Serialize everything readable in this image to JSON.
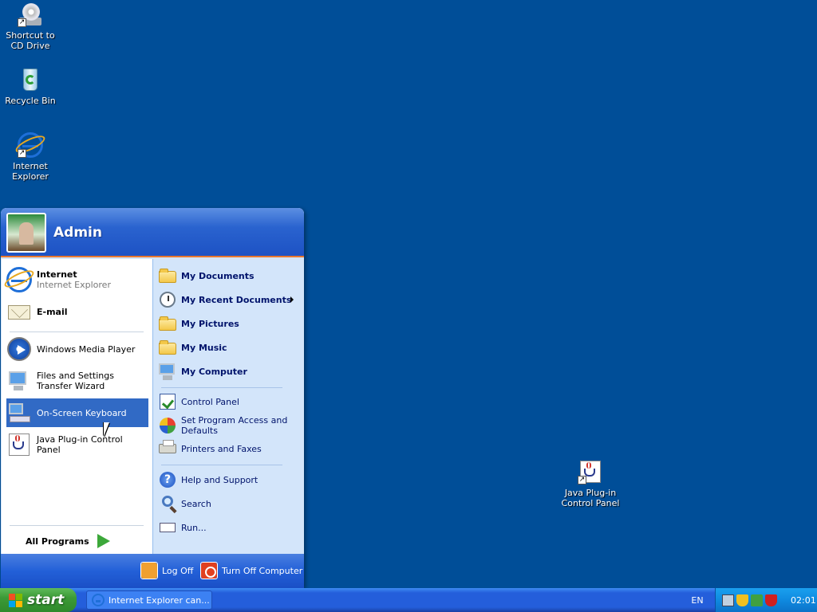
{
  "desktop": {
    "icons": [
      {
        "label": "Shortcut to CD Drive",
        "icon": "cd-drive-icon"
      },
      {
        "label": "Recycle Bin",
        "icon": "recycle-bin-icon"
      },
      {
        "label": "Internet Explorer",
        "icon": "internet-explorer-icon"
      },
      {
        "label": "Java Plug-in Control Panel",
        "icon": "java-icon"
      }
    ],
    "background_color": "#004e98"
  },
  "start_menu": {
    "user_name": "Admin",
    "pinned": [
      {
        "title": "Internet",
        "subtitle": "Internet Explorer",
        "icon": "internet-explorer-icon"
      },
      {
        "title": "E-mail",
        "icon": "email-icon"
      }
    ],
    "recent": [
      {
        "label": "Windows Media Player",
        "icon": "media-player-icon"
      },
      {
        "label": "Files and Settings Transfer Wizard",
        "icon": "transfer-wizard-icon"
      },
      {
        "label": "On-Screen Keyboard",
        "icon": "keyboard-icon",
        "highlighted": true
      },
      {
        "label": "Java Plug-in Control Panel",
        "icon": "java-icon"
      }
    ],
    "all_programs_label": "All Programs",
    "places": [
      {
        "label": "My Documents",
        "icon": "folder-icon"
      },
      {
        "label": "My Recent Documents",
        "icon": "recent-documents-icon",
        "submenu": true
      },
      {
        "label": "My Pictures",
        "icon": "folder-icon"
      },
      {
        "label": "My Music",
        "icon": "folder-icon"
      },
      {
        "label": "My Computer",
        "icon": "computer-icon"
      }
    ],
    "settings": [
      {
        "label": "Control Panel",
        "icon": "control-panel-icon"
      },
      {
        "label": "Set Program Access and Defaults",
        "icon": "program-access-icon"
      },
      {
        "label": "Printers and Faxes",
        "icon": "printer-icon"
      }
    ],
    "help": [
      {
        "label": "Help and Support",
        "icon": "help-icon"
      },
      {
        "label": "Search",
        "icon": "search-icon"
      },
      {
        "label": "Run...",
        "icon": "run-icon"
      }
    ],
    "log_off_label": "Log Off",
    "turn_off_label": "Turn Off Computer"
  },
  "taskbar": {
    "start_label": "start",
    "task_button_label": "Internet Explorer can...",
    "language": "EN",
    "clock": "02:01",
    "highlight_color": "#316ac5"
  }
}
